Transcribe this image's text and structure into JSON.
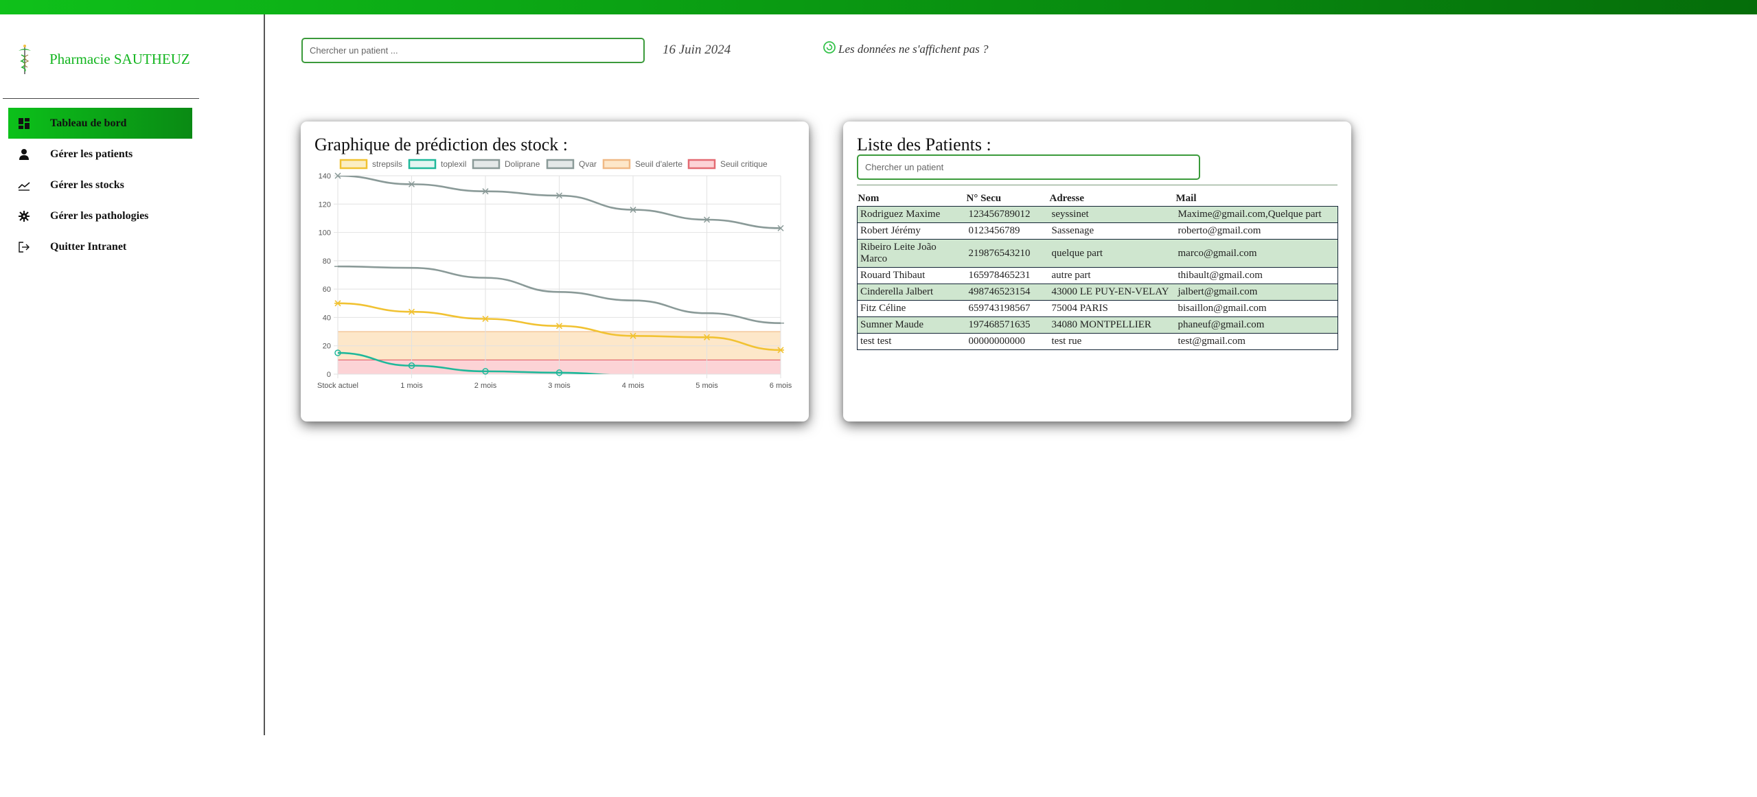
{
  "brand": {
    "name": "Pharmacie SAUTHEUZ",
    "logo_icon": "caduceus-icon",
    "accent": "#13b51f"
  },
  "sidebar": {
    "items": [
      {
        "label": "Tableau de bord",
        "icon": "dashboard-icon",
        "active": true
      },
      {
        "label": "Gérer les patients",
        "icon": "person-icon",
        "active": false
      },
      {
        "label": "Gérer les stocks",
        "icon": "trend-line-icon",
        "active": false
      },
      {
        "label": "Gérer les pathologies",
        "icon": "virus-icon",
        "active": false
      },
      {
        "label": "Quitter Intranet",
        "icon": "logout-icon",
        "active": false
      }
    ]
  },
  "header": {
    "search_placeholder": "Chercher un patient ...",
    "date": "16 Juin 2024",
    "notice": "Les données ne s'affichent pas ?",
    "notice_icon": "refresh-icon"
  },
  "chart_card": {
    "title": "Graphique de prédiction des stock :"
  },
  "chart_data": {
    "type": "line",
    "categories": [
      "Stock actuel",
      "1 mois",
      "2 mois",
      "3 mois",
      "4 mois",
      "5 mois",
      "6 mois"
    ],
    "ylim": [
      0,
      140
    ],
    "yticks": [
      0,
      20,
      40,
      60,
      80,
      100,
      120,
      140
    ],
    "grid": true,
    "legend_position": "top",
    "series": [
      {
        "name": "strepsils",
        "color": "#f1c232",
        "marker": "star",
        "values": [
          50,
          44,
          39,
          34,
          27,
          26,
          17
        ]
      },
      {
        "name": "toplexil",
        "color": "#1fb89a",
        "marker": "circle",
        "values": [
          15,
          6,
          2,
          1,
          -1,
          null,
          null
        ]
      },
      {
        "name": "Doliprane",
        "color": "#8a9a98",
        "marker": "cross",
        "values": [
          140,
          134,
          129,
          126,
          116,
          109,
          103
        ]
      },
      {
        "name": "Qvar",
        "color": "#8a9a98",
        "marker": "dash",
        "values": [
          76,
          75,
          68,
          58,
          52,
          43,
          36
        ]
      }
    ],
    "thresholds": [
      {
        "name": "Seuil d'alerte",
        "value": 30,
        "fill": "#fde7c9",
        "stroke": "#f0b985"
      },
      {
        "name": "Seuil critique",
        "value": 10,
        "fill": "#fcd3d6",
        "stroke": "#e46b73"
      }
    ]
  },
  "patients": {
    "title": "Liste des Patients :",
    "search_placeholder": "Chercher un patient",
    "columns": [
      "Nom",
      "N° Secu",
      "Adresse",
      "Mail"
    ],
    "rows": [
      [
        "Rodriguez Maxime",
        "123456789012",
        "seyssinet",
        "Maxime@gmail.com,Quelque part"
      ],
      [
        "Robert Jérémy",
        "0123456789",
        "Sassenage",
        "roberto@gmail.com"
      ],
      [
        "Ribeiro Leite João Marco",
        "219876543210",
        "quelque part",
        "marco@gmail.com"
      ],
      [
        "Rouard Thibaut",
        "165978465231",
        "autre part",
        "thibault@gmail.com"
      ],
      [
        "Cinderella Jalbert",
        "498746523154",
        "43000 LE PUY-EN-VELAY",
        "jalbert@gmail.com"
      ],
      [
        "Fitz Céline",
        "659743198567",
        "75004 PARIS",
        "bisaillon@gmail.com"
      ],
      [
        "Sumner Maude",
        "197468571635",
        "34080 MONTPELLIER",
        "phaneuf@gmail.com"
      ],
      [
        "test test",
        "00000000000",
        "test rue",
        "test@gmail.com"
      ]
    ]
  }
}
